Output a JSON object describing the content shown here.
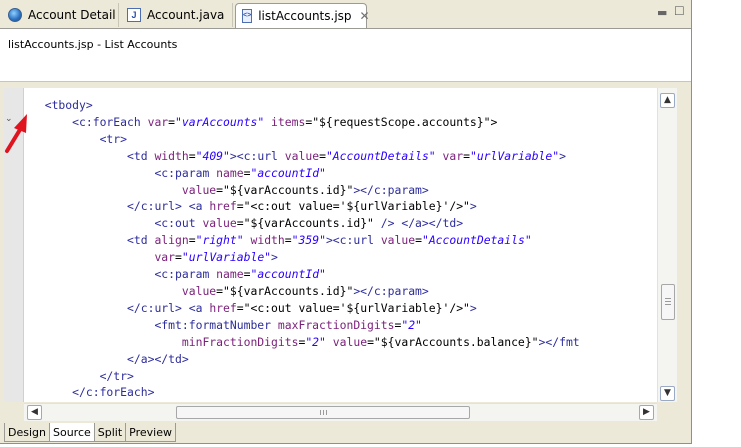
{
  "tabs": [
    {
      "label": "Account Detail",
      "icon": "globe-icon"
    },
    {
      "label": "Account.java",
      "icon": "java-file-icon"
    },
    {
      "label": "listAccounts.jsp",
      "icon": "jsp-file-icon",
      "active": true
    }
  ],
  "header": {
    "title": "listAccounts.jsp - List Accounts"
  },
  "editor": {
    "lines": [
      [
        [
          "tg",
          "  <tbody>"
        ]
      ],
      [
        [
          "tg",
          "      <c:forEach "
        ],
        [
          "at",
          "var"
        ],
        [
          "tx",
          "="
        ],
        [
          "vl",
          "\"varAccounts\""
        ],
        [
          "tx",
          " "
        ],
        [
          "at",
          "items"
        ],
        [
          "tx",
          "=\"${requestScope.accounts}\">"
        ]
      ],
      [
        [
          "tg",
          "          <tr>"
        ]
      ],
      [
        [
          "tg",
          "              <td "
        ],
        [
          "at",
          "width"
        ],
        [
          "tx",
          "="
        ],
        [
          "vl",
          "\"409\""
        ],
        [
          "tg",
          "><c:url "
        ],
        [
          "at",
          "value"
        ],
        [
          "tx",
          "="
        ],
        [
          "vl",
          "\"AccountDetails\""
        ],
        [
          "tx",
          " "
        ],
        [
          "at",
          "var"
        ],
        [
          "tx",
          "="
        ],
        [
          "vl",
          "\"urlVariable\""
        ],
        [
          "tg",
          ">"
        ]
      ],
      [
        [
          "tg",
          "                  <c:param "
        ],
        [
          "at",
          "name"
        ],
        [
          "tx",
          "="
        ],
        [
          "vl",
          "\"accountId\""
        ]
      ],
      [
        [
          "tx",
          "                      "
        ],
        [
          "at",
          "value"
        ],
        [
          "tx",
          "=\"${varAccounts.id}\""
        ],
        [
          "tg",
          "></c:param>"
        ]
      ],
      [
        [
          "tg",
          "              </c:url> <a "
        ],
        [
          "at",
          "href"
        ],
        [
          "tx",
          "=\"<c:out value='${urlVariable}'/>\""
        ],
        [
          "tg",
          ">"
        ]
      ],
      [
        [
          "tg",
          "                  <c:out "
        ],
        [
          "at",
          "value"
        ],
        [
          "tx",
          "=\"${varAccounts.id}\""
        ],
        [
          "tg",
          " /> </a></td>"
        ]
      ],
      [
        [
          "tg",
          "              <td "
        ],
        [
          "at",
          "align"
        ],
        [
          "tx",
          "="
        ],
        [
          "vl",
          "\"right\""
        ],
        [
          "tx",
          " "
        ],
        [
          "at",
          "width"
        ],
        [
          "tx",
          "="
        ],
        [
          "vl",
          "\"359\""
        ],
        [
          "tg",
          "><c:url "
        ],
        [
          "at",
          "value"
        ],
        [
          "tx",
          "="
        ],
        [
          "vl",
          "\"AccountDetails\""
        ]
      ],
      [
        [
          "tx",
          "                  "
        ],
        [
          "at",
          "var"
        ],
        [
          "tx",
          "="
        ],
        [
          "vl",
          "\"urlVariable\""
        ],
        [
          "tg",
          ">"
        ]
      ],
      [
        [
          "tg",
          "                  <c:param "
        ],
        [
          "at",
          "name"
        ],
        [
          "tx",
          "="
        ],
        [
          "vl",
          "\"accountId\""
        ]
      ],
      [
        [
          "tx",
          "                      "
        ],
        [
          "at",
          "value"
        ],
        [
          "tx",
          "=\"${varAccounts.id}\""
        ],
        [
          "tg",
          "></c:param>"
        ]
      ],
      [
        [
          "tg",
          "              </c:url> <a "
        ],
        [
          "at",
          "href"
        ],
        [
          "tx",
          "=\"<c:out value='${urlVariable}'/>\""
        ],
        [
          "tg",
          ">"
        ]
      ],
      [
        [
          "tg",
          "                  <fmt:formatNumber "
        ],
        [
          "at",
          "maxFractionDigits"
        ],
        [
          "tx",
          "="
        ],
        [
          "vl",
          "\"2\""
        ]
      ],
      [
        [
          "tx",
          "                      "
        ],
        [
          "at",
          "minFractionDigits"
        ],
        [
          "tx",
          "="
        ],
        [
          "vl",
          "\"2\""
        ],
        [
          "tx",
          " "
        ],
        [
          "at",
          "value"
        ],
        [
          "tx",
          "=\"${varAccounts.balance}\""
        ],
        [
          "tg",
          "></fmt"
        ]
      ],
      [
        [
          "tg",
          "              </a></td>"
        ]
      ],
      [
        [
          "tg",
          "          </tr>"
        ]
      ],
      [
        [
          "tg",
          "      </c:forEach>"
        ]
      ]
    ]
  },
  "bottom_tabs": [
    {
      "label": "Design"
    },
    {
      "label": "Source",
      "active": true
    },
    {
      "label": "Split"
    },
    {
      "label": "Preview"
    }
  ],
  "colors": {
    "tag": "#2d2d9c",
    "attribute": "#7a1f7a",
    "value": "#2a00ff",
    "arrow": "#e0141e"
  }
}
